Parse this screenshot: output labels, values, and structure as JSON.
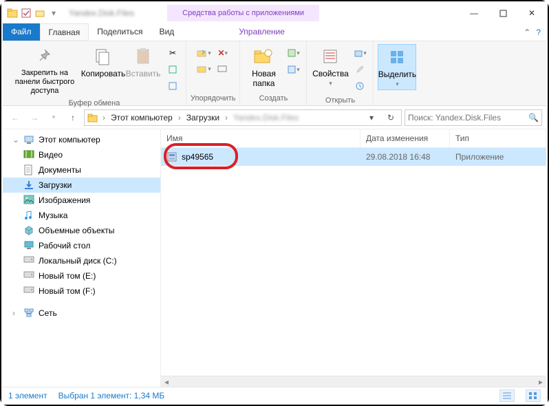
{
  "titlebar": {
    "context_tab": "Средства работы с приложениями",
    "minimize": "—",
    "maximize": "▢",
    "close": "✕"
  },
  "tabs": {
    "file": "Файл",
    "home": "Главная",
    "share": "Поделиться",
    "view": "Вид",
    "manage": "Управление"
  },
  "ribbon": {
    "pin": "Закрепить на панели быстрого доступа",
    "copy": "Копировать",
    "paste": "Вставить",
    "group_clipboard": "Буфер обмена",
    "group_organize": "Упорядочить",
    "new_folder": "Новая папка",
    "group_new": "Создать",
    "properties": "Свойства",
    "group_open": "Открыть",
    "select": "Выделить"
  },
  "nav": {
    "this_pc": "Этот компьютер",
    "downloads": "Загрузки",
    "search_placeholder": "Поиск: Yandex.Disk.Files"
  },
  "tree": {
    "this_pc": "Этот компьютер",
    "video": "Видео",
    "documents": "Документы",
    "downloads": "Загрузки",
    "pictures": "Изображения",
    "music": "Музыка",
    "objects3d": "Объемные объекты",
    "desktop": "Рабочий стол",
    "drive_c": "Локальный диск (C:)",
    "drive_e": "Новый том (E:)",
    "drive_f": "Новый том (F:)",
    "network": "Сеть"
  },
  "columns": {
    "name": "Имя",
    "date": "Дата изменения",
    "type": "Тип"
  },
  "files": [
    {
      "name": "sp49565",
      "date": "29.08.2018 16:48",
      "type": "Приложение"
    }
  ],
  "status": {
    "count": "1 элемент",
    "selection": "Выбран 1 элемент: 1,34 МБ"
  }
}
